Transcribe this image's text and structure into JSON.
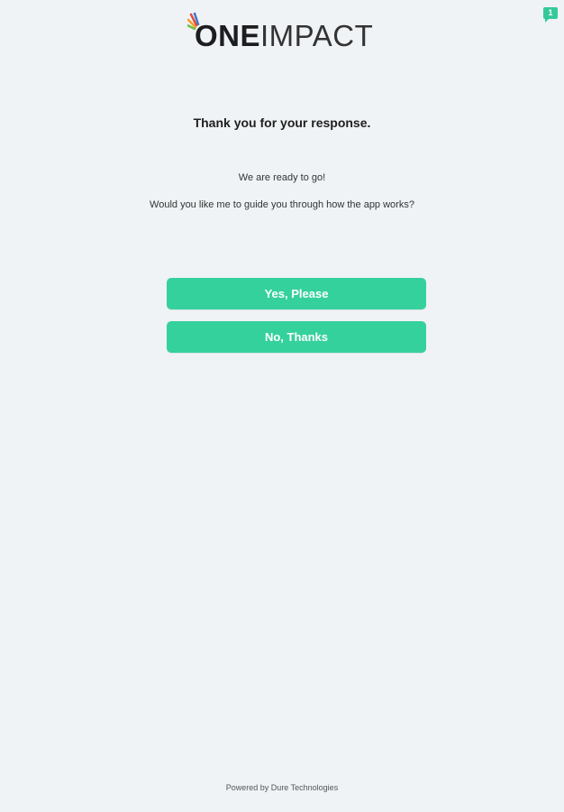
{
  "brand": {
    "logo_part1": "ONE",
    "logo_part2": "IMPACT",
    "accent_color": "#35d19d"
  },
  "notification": {
    "count": "1",
    "icon": "chat-bubble-icon"
  },
  "content": {
    "heading": "Thank you for your response.",
    "line1": "We are ready to go!",
    "line2": "Would you like me to guide you through how the app works?"
  },
  "buttons": {
    "yes_label": "Yes, Please",
    "no_label": "No, Thanks"
  },
  "footer": {
    "text": "Powered by Dure Technologies"
  }
}
